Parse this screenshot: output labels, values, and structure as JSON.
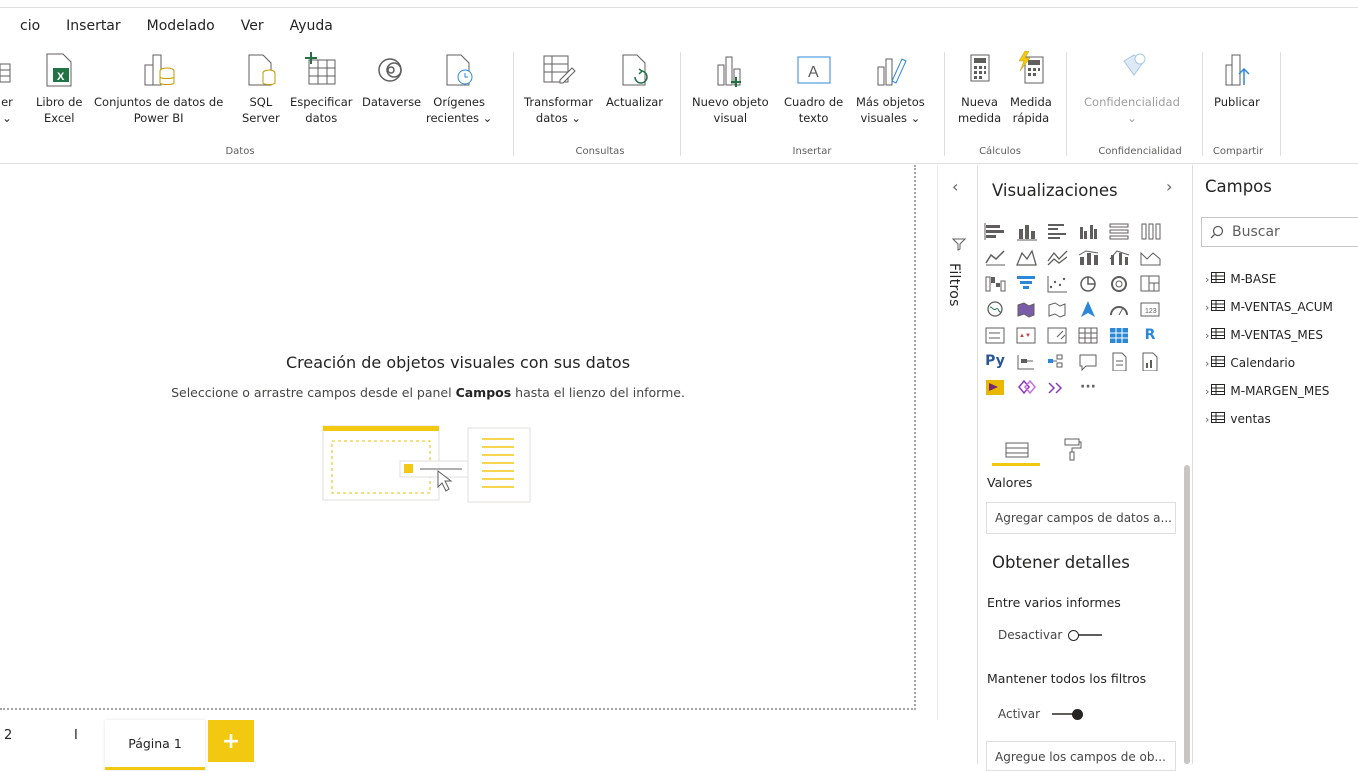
{
  "menu": {
    "items": [
      "cio",
      "Insertar",
      "Modelado",
      "Ver",
      "Ayuda"
    ]
  },
  "ribbon": {
    "buttons": [
      {
        "l1": "er",
        "l2": "⌄"
      },
      {
        "l1": "Libro de",
        "l2": "Excel"
      },
      {
        "l1": "Conjuntos de datos de",
        "l2": "Power BI"
      },
      {
        "l1": "SQL",
        "l2": "Server"
      },
      {
        "l1": "Especificar",
        "l2": "datos"
      },
      {
        "l1": "Dataverse",
        "l2": ""
      },
      {
        "l1": "Orígenes",
        "l2": "recientes ⌄"
      },
      {
        "l1": "Transformar",
        "l2": "datos ⌄"
      },
      {
        "l1": "Actualizar",
        "l2": ""
      },
      {
        "l1": "Nuevo objeto",
        "l2": "visual"
      },
      {
        "l1": "Cuadro de",
        "l2": "texto"
      },
      {
        "l1": "Más objetos",
        "l2": "visuales ⌄"
      },
      {
        "l1": "Nueva",
        "l2": "medida"
      },
      {
        "l1": "Medida",
        "l2": "rápida"
      },
      {
        "l1": "Confidencialidad",
        "l2": "⌄"
      },
      {
        "l1": "Publicar",
        "l2": ""
      }
    ],
    "groups": [
      "Datos",
      "Consultas",
      "Insertar",
      "Cálculos",
      "Confidencialidad",
      "Compartir"
    ]
  },
  "canvas": {
    "title": "Creación de objetos visuales con sus datos",
    "subtitle_before": "Seleccione o arrastre campos desde el panel ",
    "subtitle_bold": "Campos",
    "subtitle_after": " hasta el lienzo del informe."
  },
  "filters": {
    "label": "Filtros",
    "chevron": "‹"
  },
  "visualizations": {
    "title": "Visualizaciones",
    "chevron": "›",
    "values_label": "Valores",
    "values_placeholder": "Agregar campos de datos a...",
    "details_title": "Obtener detalles",
    "cross_report_label": "Entre varios informes",
    "cross_report_toggle": "Desactivar",
    "keep_filters_label": "Mantener todos los filtros",
    "keep_filters_toggle": "Activar",
    "drillthrough_placeholder": "Agregue los campos de ob...",
    "icons": [
      "stacked-bar",
      "stacked-column",
      "clustered-bar",
      "clustered-column",
      "100-bar",
      "100-column",
      "line",
      "area",
      "stacked-area",
      "line-column",
      "line-clustered",
      "ribbon",
      "waterfall",
      "funnel",
      "scatter",
      "pie",
      "donut",
      "treemap",
      "map",
      "filled-map",
      "shape-map",
      "azure-map",
      "gauge",
      "card",
      "multi-row-card",
      "kpi",
      "slicer",
      "table",
      "matrix",
      "r-visual",
      "python",
      "key-influencers",
      "decomp-tree",
      "qna",
      "smart-narrative",
      "paginated",
      "power-apps",
      "power-automate",
      "arcgis",
      "more"
    ],
    "more_glyph": "···",
    "r_glyph": "R",
    "py_glyph": "Py"
  },
  "fields": {
    "title": "Campos",
    "search_placeholder": "Buscar",
    "tables": [
      "M-BASE",
      "M-VENTAS_ACUM",
      "M-VENTAS_MES",
      "Calendario",
      "M-MARGEN_MES",
      "ventas"
    ]
  },
  "pages": {
    "prev_label": "2",
    "sep_label": "I",
    "active": "Página 1",
    "add": "+"
  },
  "colors": {
    "accent": "#f2c811",
    "excel": "#217346",
    "blue": "#2b88d8"
  }
}
